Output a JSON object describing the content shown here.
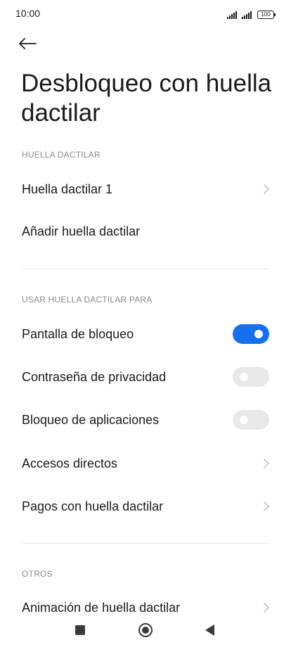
{
  "status_bar": {
    "time": "10:00",
    "battery": "100"
  },
  "page": {
    "title": "Desbloqueo con huella dactilar"
  },
  "sections": {
    "fingerprint": {
      "header": "HUELLA DACTILAR",
      "items": [
        {
          "label": "Huella dactilar 1",
          "type": "chevron"
        },
        {
          "label": "Añadir huella dactilar",
          "type": "action"
        }
      ]
    },
    "use_for": {
      "header": "USAR HUELLA DACTILAR PARA",
      "items": [
        {
          "label": "Pantalla de bloqueo",
          "type": "toggle",
          "enabled": true
        },
        {
          "label": "Contraseña de privacidad",
          "type": "toggle",
          "enabled": false
        },
        {
          "label": "Bloqueo de aplicaciones",
          "type": "toggle",
          "enabled": false
        },
        {
          "label": "Accesos directos",
          "type": "chevron"
        },
        {
          "label": "Pagos con huella dactilar",
          "type": "chevron"
        }
      ]
    },
    "others": {
      "header": "OTROS",
      "items": [
        {
          "label": "Animación de huella dactilar",
          "type": "chevron"
        }
      ]
    }
  },
  "colors": {
    "accent": "#1570ef",
    "toggle_off": "#e8e8e8",
    "section_header": "#8a8a8a",
    "text": "#1a1a1a"
  },
  "icons": {
    "back": "arrow-left-icon",
    "chevron": "chevron-right-icon",
    "nav_recents": "square-icon",
    "nav_home": "circle-icon",
    "nav_back": "triangle-left-icon"
  }
}
